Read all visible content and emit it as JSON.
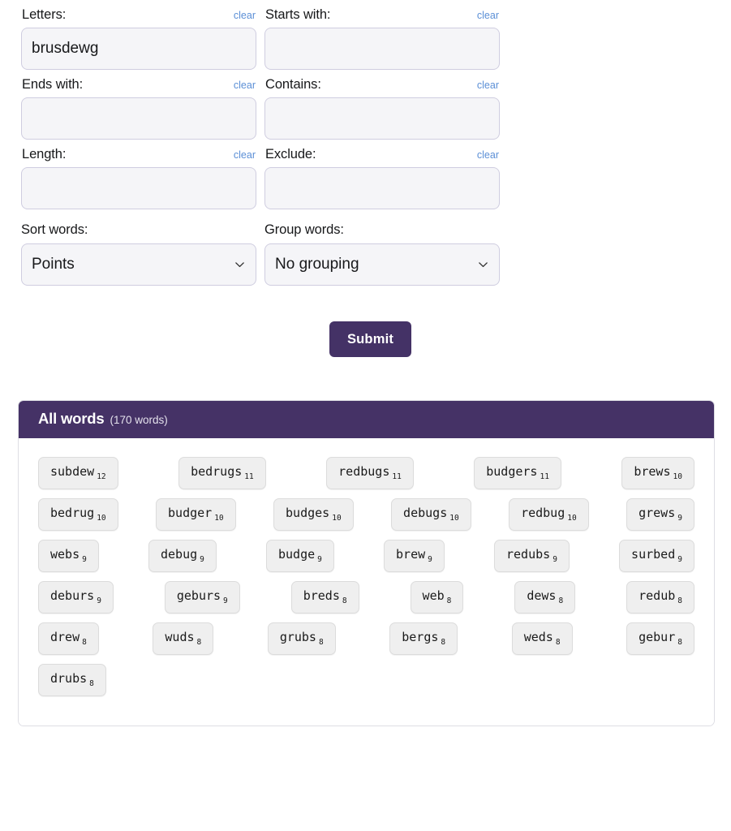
{
  "form": {
    "clear_label": "clear",
    "fields": [
      {
        "label": "Letters:",
        "value": "brusdewg",
        "placeholder": ""
      },
      {
        "label": "Starts with:",
        "value": "",
        "placeholder": ""
      },
      {
        "label": "Ends with:",
        "value": "",
        "placeholder": ""
      },
      {
        "label": "Contains:",
        "value": "",
        "placeholder": ""
      },
      {
        "label": "Length:",
        "value": "",
        "placeholder": ""
      },
      {
        "label": "Exclude:",
        "value": "",
        "placeholder": ""
      }
    ],
    "selects": [
      {
        "label": "Sort words:",
        "value": "Points",
        "icon": "chevron-down-icon"
      },
      {
        "label": "Group words:",
        "value": "No grouping",
        "icon": "chevron-down-icon"
      }
    ],
    "submit_label": "Submit"
  },
  "results": {
    "title": "All words",
    "count_label": "(170 words)",
    "rows": [
      [
        {
          "word": "subdew",
          "points": "12"
        },
        {
          "word": "bedrugs",
          "points": "11"
        },
        {
          "word": "redbugs",
          "points": "11"
        },
        {
          "word": "budgers",
          "points": "11"
        },
        {
          "word": "brews",
          "points": "10"
        }
      ],
      [
        {
          "word": "bedrug",
          "points": "10"
        },
        {
          "word": "budger",
          "points": "10"
        },
        {
          "word": "budges",
          "points": "10"
        },
        {
          "word": "debugs",
          "points": "10"
        },
        {
          "word": "redbug",
          "points": "10"
        },
        {
          "word": "grews",
          "points": "9"
        }
      ],
      [
        {
          "word": "webs",
          "points": "9"
        },
        {
          "word": "debug",
          "points": "9"
        },
        {
          "word": "budge",
          "points": "9"
        },
        {
          "word": "brew",
          "points": "9"
        },
        {
          "word": "redubs",
          "points": "9"
        },
        {
          "word": "surbed",
          "points": "9"
        }
      ],
      [
        {
          "word": "deburs",
          "points": "9"
        },
        {
          "word": "geburs",
          "points": "9"
        },
        {
          "word": "breds",
          "points": "8"
        },
        {
          "word": "web",
          "points": "8"
        },
        {
          "word": "dews",
          "points": "8"
        },
        {
          "word": "redub",
          "points": "8"
        }
      ],
      [
        {
          "word": "drew",
          "points": "8"
        },
        {
          "word": "wuds",
          "points": "8"
        },
        {
          "word": "grubs",
          "points": "8"
        },
        {
          "word": "bergs",
          "points": "8"
        },
        {
          "word": "weds",
          "points": "8"
        },
        {
          "word": "gebur",
          "points": "8"
        }
      ],
      [
        {
          "word": "drubs",
          "points": "8"
        }
      ]
    ]
  },
  "colors": {
    "accent": "#443266",
    "header_bg": "#453266",
    "link": "#5b8fd6",
    "input_bg": "#f5f5f8",
    "input_border": "#cfcde0",
    "chip_bg": "#efefef"
  }
}
